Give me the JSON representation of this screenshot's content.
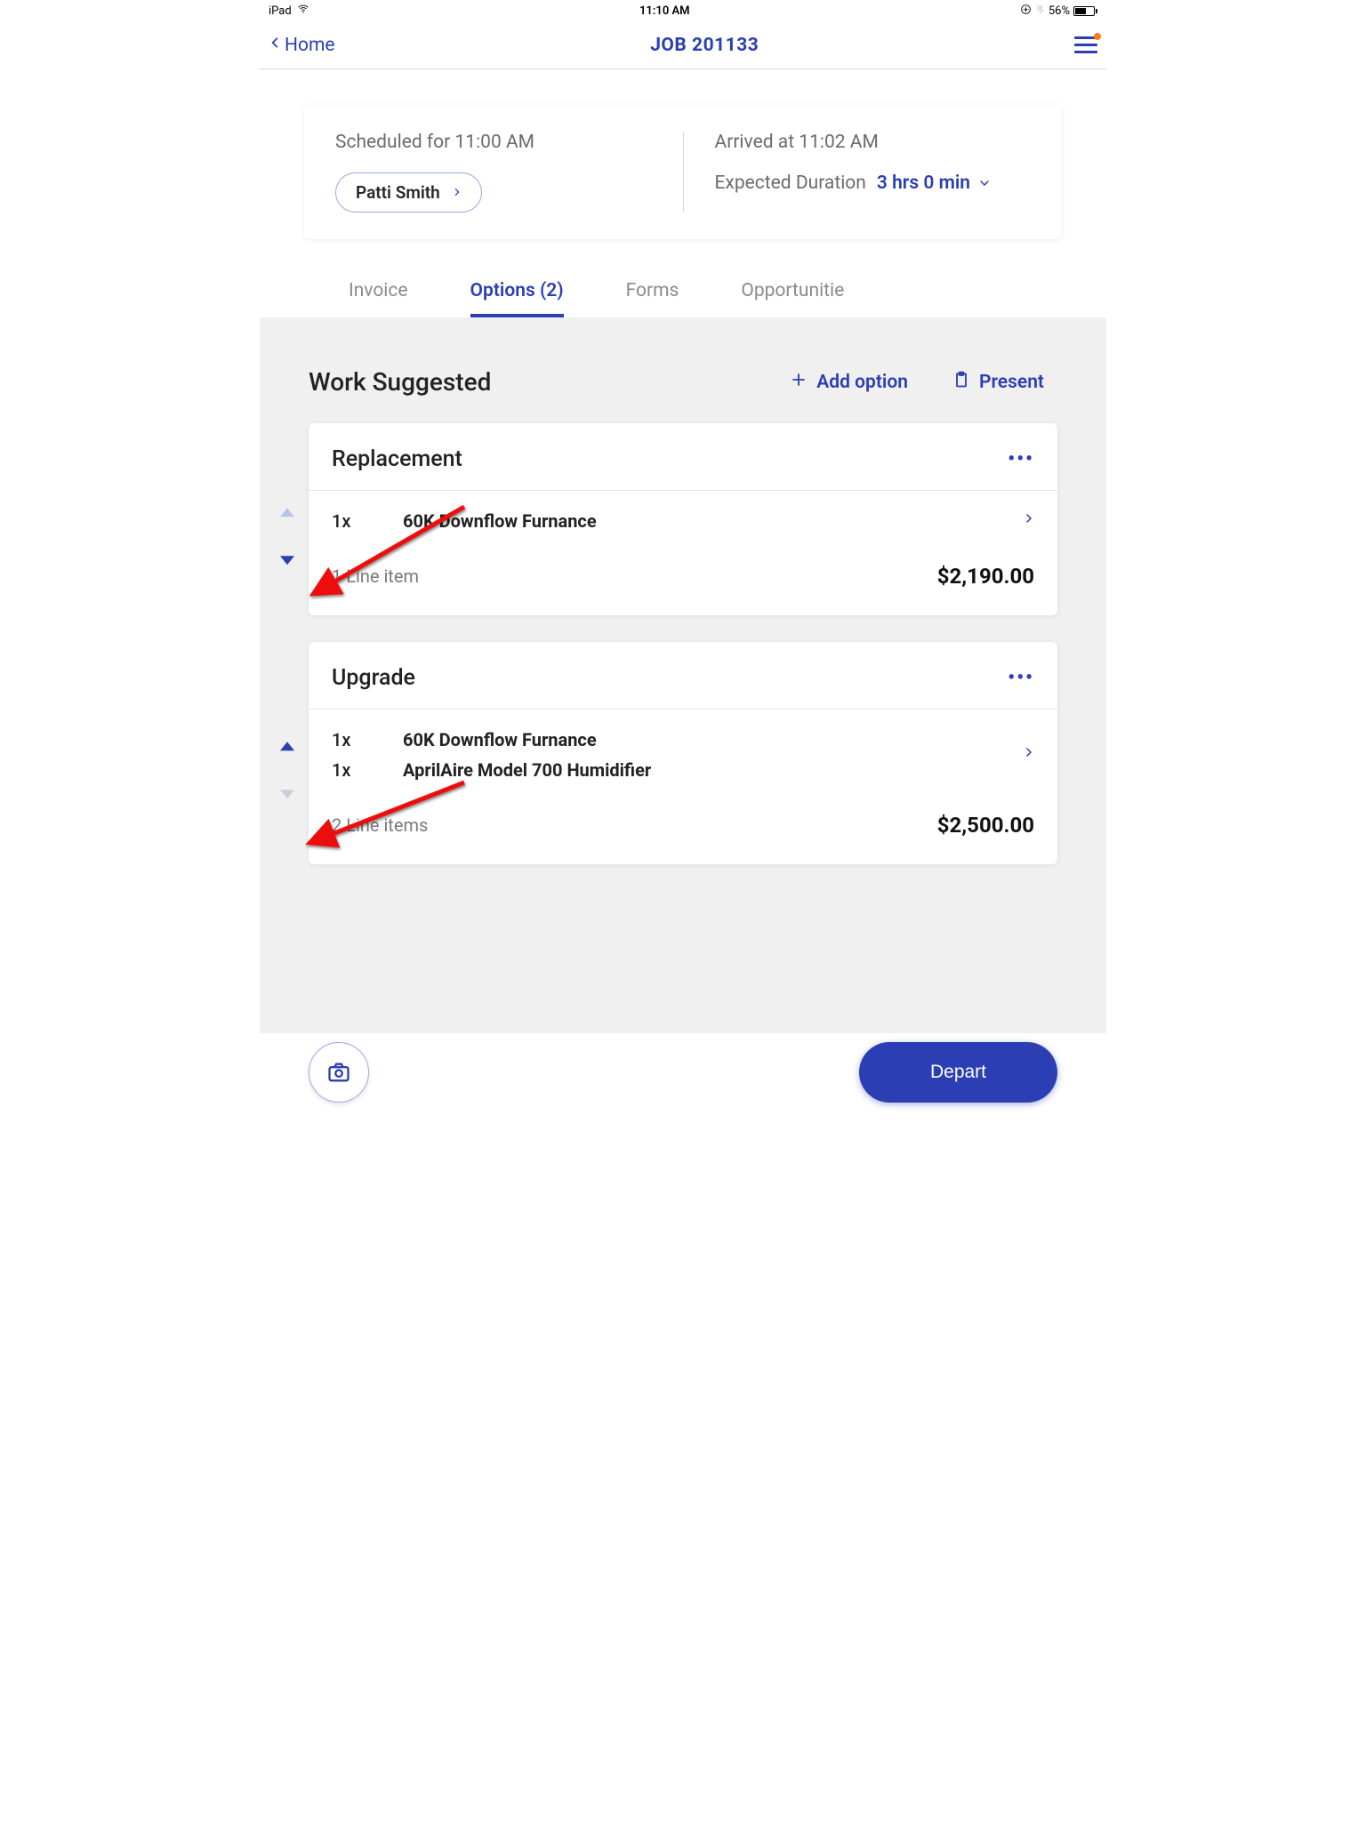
{
  "status": {
    "device": "iPad",
    "time": "11:10 AM",
    "battery_pct": "56%"
  },
  "nav": {
    "back_label": "Home",
    "title": "JOB 201133"
  },
  "summary": {
    "scheduled": "Scheduled for 11:00 AM",
    "technician": "Patti Smith",
    "arrived": "Arrived at 11:02 AM",
    "duration_label": "Expected Duration",
    "duration_value": "3 hrs 0 min"
  },
  "tabs": {
    "invoice": "Invoice",
    "options": "Options (2)",
    "forms": "Forms",
    "opportunities": "Opportunitie"
  },
  "section": {
    "title": "Work Suggested",
    "add_option": "Add option",
    "present": "Present"
  },
  "options": [
    {
      "title": "Replacement",
      "items": [
        {
          "qty": "1x",
          "name": "60K Downflow Furnance"
        }
      ],
      "count_label": "1 Line item",
      "total": "$2,190.00"
    },
    {
      "title": "Upgrade",
      "items": [
        {
          "qty": "1x",
          "name": "60K Downflow Furnance"
        },
        {
          "qty": "1x",
          "name": "AprilAire Model 700 Humidifier"
        }
      ],
      "count_label": "2 Line items",
      "total": "$2,500.00"
    }
  ],
  "footer": {
    "depart": "Depart"
  }
}
